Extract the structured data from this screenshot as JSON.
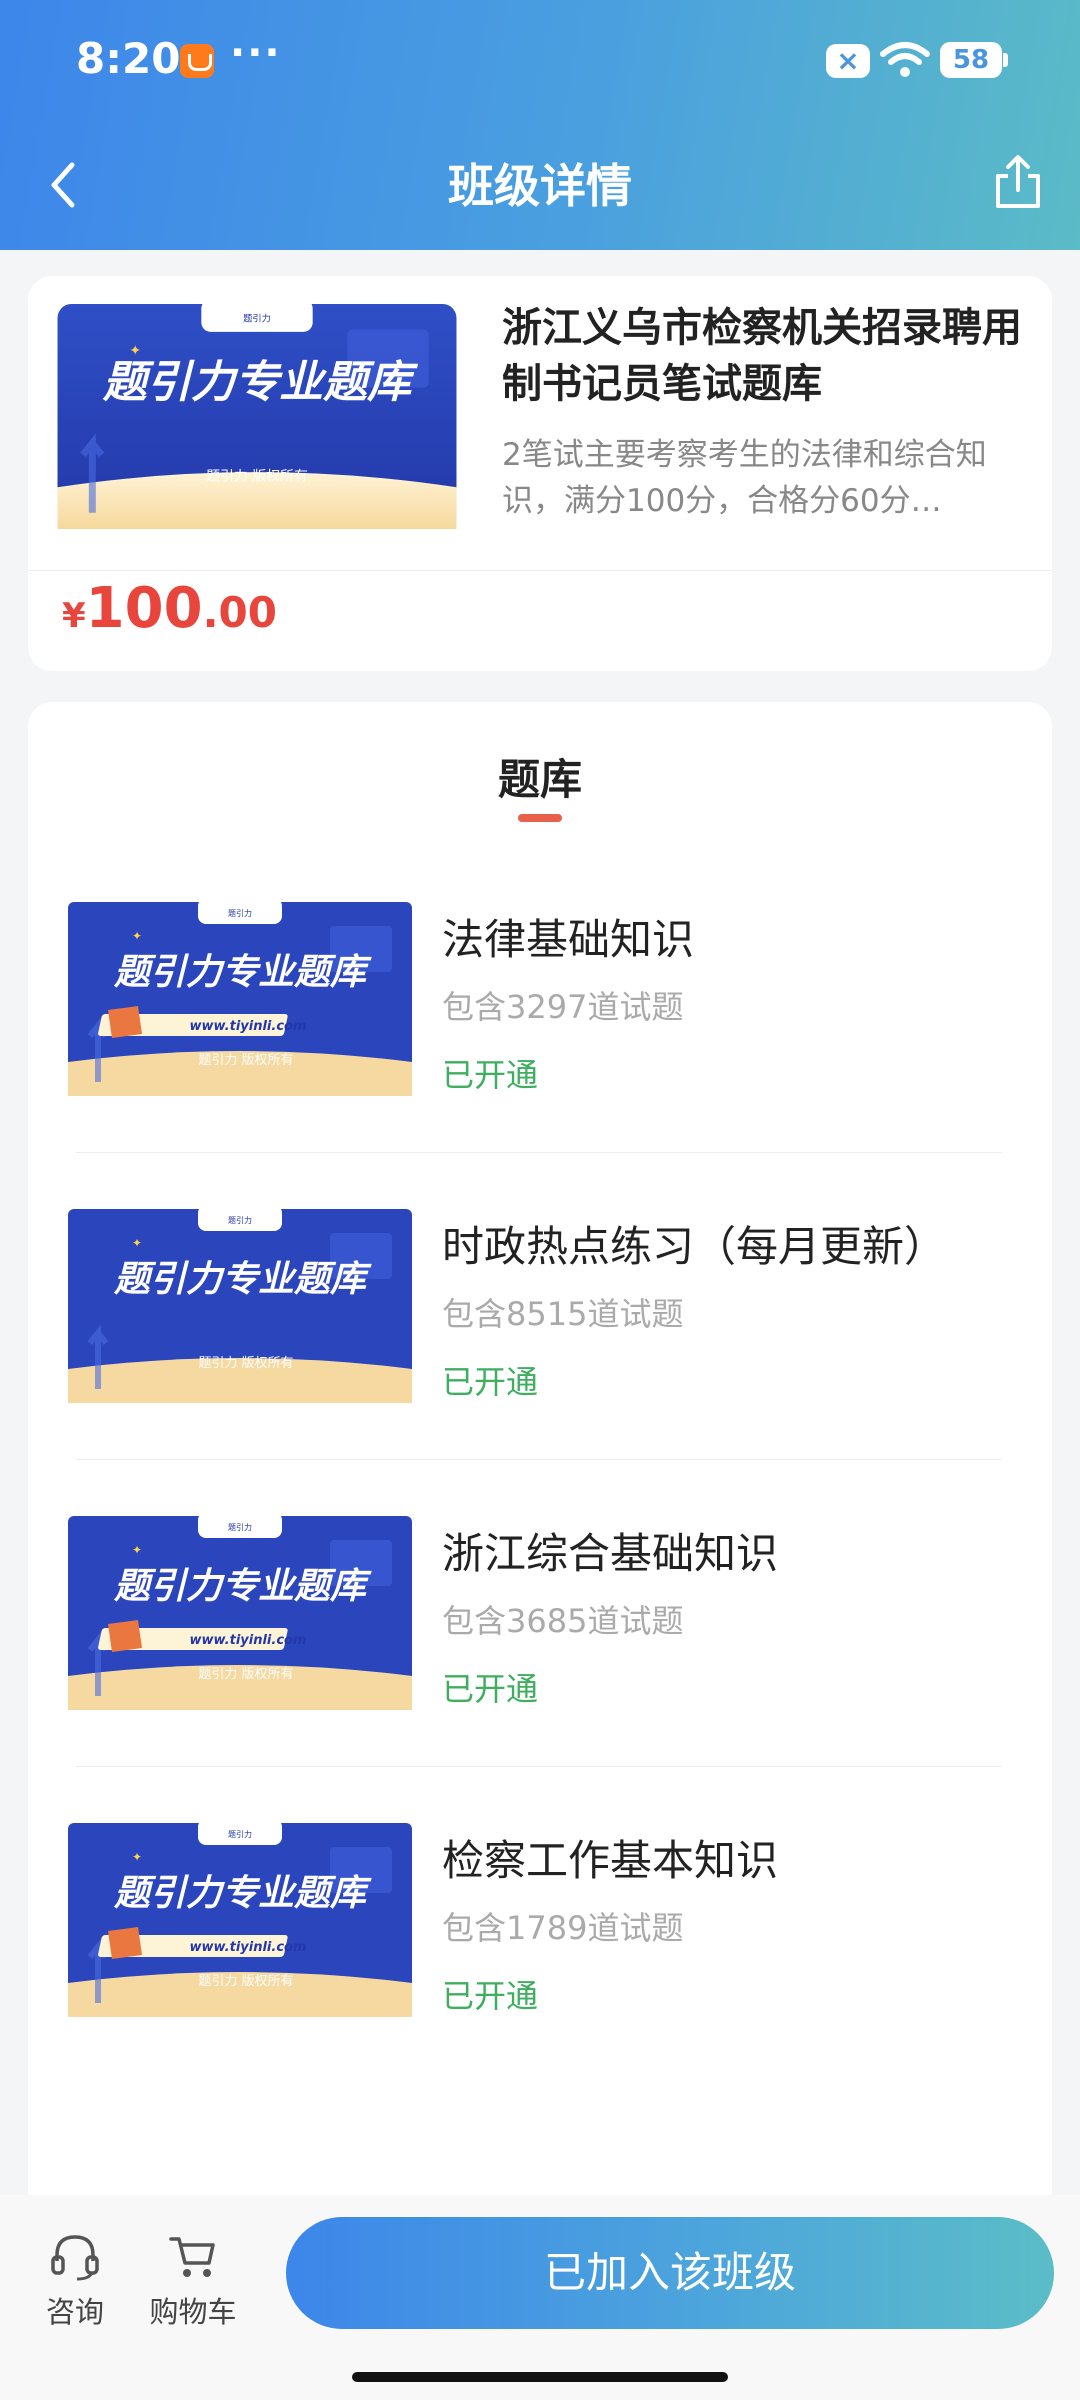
{
  "status_bar": {
    "time": "8:20",
    "more": "···",
    "battery": "58"
  },
  "header": {
    "title": "班级详情"
  },
  "course": {
    "title": "浙江义乌市检察机关招录聘用制书记员笔试题库",
    "description": "2笔试主要考察考生的法律和综合知识，满分100分，合格分60分…",
    "price_currency": "¥",
    "price_int": "100",
    "price_dec": ".00"
  },
  "thumbnail": {
    "logo_text": "题引力",
    "banner": "题引力专业题库",
    "url": "www.tiyinli.com",
    "copyright": "题引力 版权所有"
  },
  "bank": {
    "tab": "题库",
    "items": [
      {
        "name": "法律基础知识",
        "count": "包含3297道试题",
        "status": "已开通",
        "show_url": true
      },
      {
        "name": "时政热点练习（每月更新）",
        "count": "包含8515道试题",
        "status": "已开通",
        "show_url": false
      },
      {
        "name": "浙江综合基础知识",
        "count": "包含3685道试题",
        "status": "已开通",
        "show_url": true
      },
      {
        "name": "检察工作基本知识",
        "count": "包含1789道试题",
        "status": "已开通",
        "show_url": true
      }
    ]
  },
  "bottom": {
    "consult": "咨询",
    "cart": "购物车",
    "join": "已加入该班级"
  },
  "colors": {
    "accent": "#3d86ea",
    "price": "#e8453c",
    "status_green": "#3fae5f",
    "tab_underline": "#e8604a"
  },
  "icons": [
    "back-arrow-icon",
    "share-icon",
    "headset-icon",
    "cart-icon",
    "wifi-icon",
    "close-icon"
  ]
}
